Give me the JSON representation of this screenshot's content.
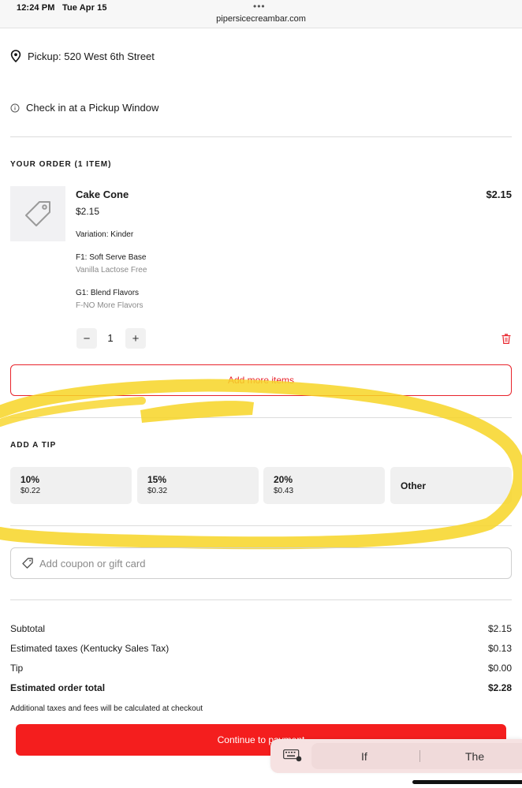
{
  "status": {
    "time": "12:24 PM",
    "date": "Tue Apr 15",
    "url": "pipersicecreambar.com"
  },
  "pickup": {
    "icon": "location-pin-icon",
    "label": "Pickup: 520 West 6th Street"
  },
  "checkin": {
    "icon": "info-icon",
    "label": "Check in at a Pickup Window"
  },
  "order": {
    "title": "YOUR ORDER (1 ITEM)",
    "item": {
      "name": "Cake Cone",
      "price": "$2.15",
      "line_total": "$2.15",
      "variation": "Variation: Kinder",
      "modifiers": [
        {
          "label": "F1: Soft Serve Base",
          "value": "Vanilla Lactose Free"
        },
        {
          "label": "G1: Blend Flavors",
          "value": "F-NO More Flavors"
        }
      ],
      "quantity": "1",
      "decrement": "−",
      "increment": "+",
      "thumbnail_icon": "price-tag-icon",
      "delete_icon": "trash-icon"
    },
    "add_more_label": "Add more items"
  },
  "tip": {
    "title": "ADD A TIP",
    "options": [
      {
        "percent": "10%",
        "amount": "$0.22"
      },
      {
        "percent": "15%",
        "amount": "$0.32"
      },
      {
        "percent": "20%",
        "amount": "$0.43"
      }
    ],
    "other_label": "Other"
  },
  "coupon": {
    "placeholder": "Add coupon or gift card",
    "icon": "coupon-tag-icon"
  },
  "summary": {
    "subtotal_label": "Subtotal",
    "subtotal": "$2.15",
    "taxes_label": "Estimated taxes (Kentucky Sales Tax)",
    "taxes": "$0.13",
    "tip_label": "Tip",
    "tip": "$0.00",
    "total_label": "Estimated order total",
    "total": "$2.28",
    "note": "Additional taxes and fees will be calculated at checkout"
  },
  "continue_label": "Continue to payment",
  "keyboard_suggestions": {
    "word_1": "If",
    "word_2": "The",
    "icon": "keyboard-icon"
  },
  "colors": {
    "accent": "#e8232b",
    "button": "#f41e1e",
    "highlight": "#f7d526"
  }
}
